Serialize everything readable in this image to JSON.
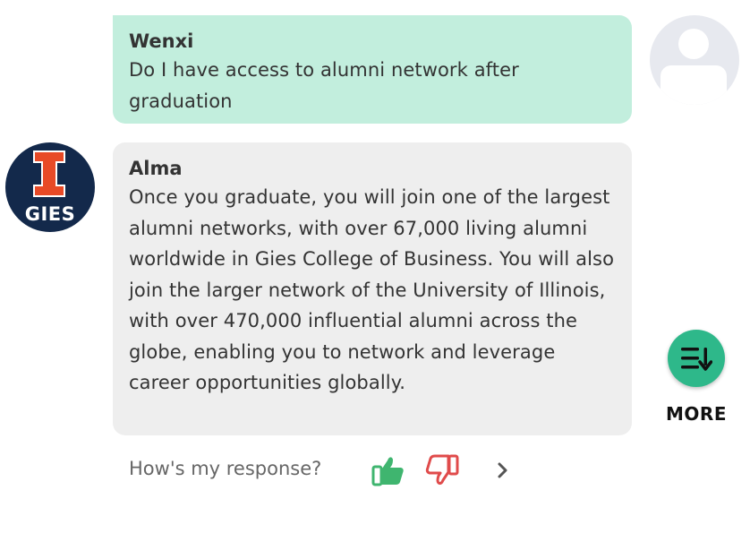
{
  "user_message": {
    "sender": "Wenxi",
    "text": "Do I have access to alumni network after graduation",
    "avatar_icon": "user-placeholder-icon",
    "bubble_color": "#c2eedd"
  },
  "bot_message": {
    "sender": "Alma",
    "text": "Once you graduate, you will join one of the largest alumni networks, with over 67,000 living alumni worldwide in Gies College of Business. You will also join the larger network of the University of Illinois, with over 470,000 influential alumni across the globe, enabling you to network and leverage career opportunities globally.",
    "avatar_label": "GIES",
    "avatar_icon": "illinois-block-i-logo",
    "bubble_color": "#eeeeee"
  },
  "feedback": {
    "prompt": "How's my response?",
    "thumbs_up_icon": "thumbs-up-icon",
    "thumbs_down_icon": "thumbs-down-icon",
    "next_icon": "chevron-right-icon",
    "colors": {
      "thumbs_up": "#3fb56f",
      "thumbs_down": "#e04b4b"
    }
  },
  "more": {
    "label": "MORE",
    "icon": "sort-list-icon",
    "color": "#2eb88a"
  }
}
